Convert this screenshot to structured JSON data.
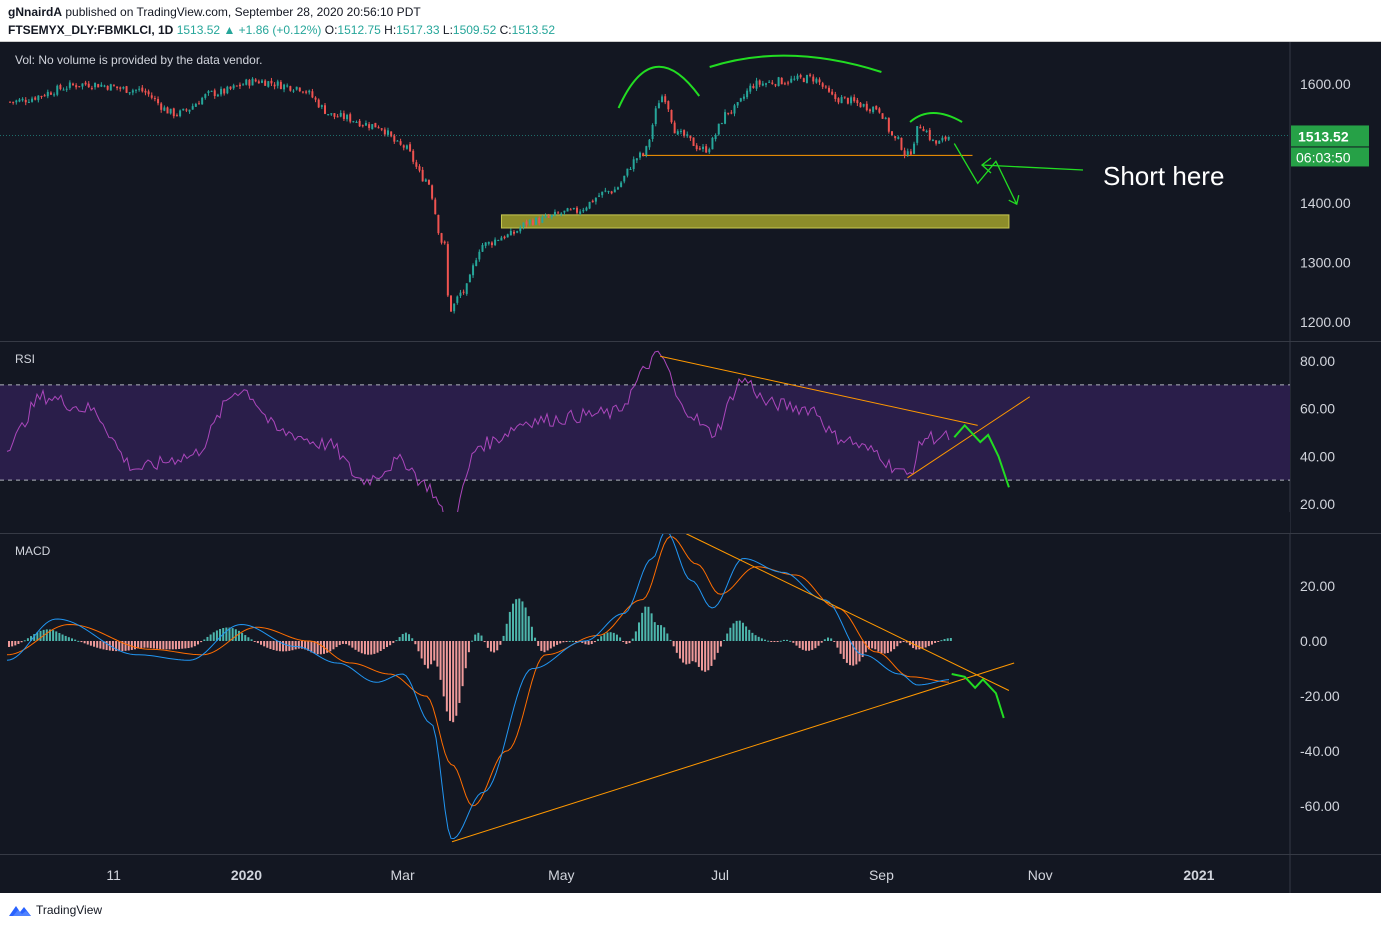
{
  "header": {
    "publisher_user": "gNnairdA",
    "published_text": "published on TradingView.com, September 28, 2020 20:56:10 PDT",
    "symbol": "FTSEMYX_DLY:FBMKLCI, 1D",
    "last": "1513.52",
    "change": "+1.86 (+0.12%)",
    "o_label": "O:",
    "open": "1512.75",
    "h_label": "H:",
    "high": "1517.33",
    "l_label": "L:",
    "low": "1509.52",
    "c_label": "C:",
    "close": "1513.52"
  },
  "footer": {
    "brand": "TradingView",
    "logo_icon": "tradingview-logo-icon"
  },
  "colors": {
    "background": "#131722",
    "up": "#26a69a",
    "down": "#ef5350",
    "rsi_line": "#ab47bc",
    "rsi_band": "#2a1e4a",
    "macd_line": "#2196f3",
    "signal_line": "#ff6d00",
    "trend_line": "#ff9800",
    "annotation": "#22dd22",
    "support_zone": "#8d8d2a"
  },
  "chart_data": [
    {
      "type": "candlestick",
      "panel": "price",
      "title": "FTSEMYX_DLY:FBMKLCI, 1D",
      "legend": "Vol: No volume is provided by the data vendor.",
      "x_tick_labels": [
        "11",
        "2020",
        "Mar",
        "May",
        "Jul",
        "Sep",
        "Nov",
        "2021"
      ],
      "y_tick_labels": [
        "1600.00",
        "1400.00",
        "1300.00",
        "1200.00"
      ],
      "ylim": [
        1170,
        1640
      ],
      "last_price_label": "1513.52",
      "countdown_label": "06:03:50",
      "annotation_text": "Short here",
      "anchor_prices": [
        {
          "date": "2019-10-01",
          "price": 1570
        },
        {
          "date": "2019-11-01",
          "price": 1600
        },
        {
          "date": "2019-11-20",
          "price": 1590
        },
        {
          "date": "2019-12-05",
          "price": 1550
        },
        {
          "date": "2019-12-20",
          "price": 1585
        },
        {
          "date": "2020-01-05",
          "price": 1605
        },
        {
          "date": "2020-01-20",
          "price": 1595
        },
        {
          "date": "2020-02-05",
          "price": 1545
        },
        {
          "date": "2020-02-20",
          "price": 1530
        },
        {
          "date": "2020-03-01",
          "price": 1495
        },
        {
          "date": "2020-03-10",
          "price": 1440
        },
        {
          "date": "2020-03-17",
          "price": 1330
        },
        {
          "date": "2020-03-19",
          "price": 1220
        },
        {
          "date": "2020-03-24",
          "price": 1250
        },
        {
          "date": "2020-04-01",
          "price": 1330
        },
        {
          "date": "2020-04-10",
          "price": 1345
        },
        {
          "date": "2020-04-20",
          "price": 1370
        },
        {
          "date": "2020-05-05",
          "price": 1385
        },
        {
          "date": "2020-05-20",
          "price": 1420
        },
        {
          "date": "2020-06-01",
          "price": 1480
        },
        {
          "date": "2020-06-09",
          "price": 1580
        },
        {
          "date": "2020-06-15",
          "price": 1515
        },
        {
          "date": "2020-06-25",
          "price": 1490
        },
        {
          "date": "2020-07-05",
          "price": 1555
        },
        {
          "date": "2020-07-15",
          "price": 1600
        },
        {
          "date": "2020-07-25",
          "price": 1605
        },
        {
          "date": "2020-08-05",
          "price": 1610
        },
        {
          "date": "2020-08-15",
          "price": 1575
        },
        {
          "date": "2020-08-30",
          "price": 1560
        },
        {
          "date": "2020-09-07",
          "price": 1505
        },
        {
          "date": "2020-09-11",
          "price": 1480
        },
        {
          "date": "2020-09-16",
          "price": 1530
        },
        {
          "date": "2020-09-22",
          "price": 1500
        },
        {
          "date": "2020-09-28",
          "price": 1513.52
        }
      ],
      "neckline": {
        "start_date": "2020-06-01",
        "end_date": "2020-10-06",
        "price": 1480
      },
      "support_zone": {
        "start_date": "2020-04-08",
        "end_date": "2020-10-20",
        "price_low": 1358,
        "price_high": 1380
      },
      "projection_path": [
        {
          "date": "2020-09-29",
          "price": 1500
        },
        {
          "date": "2020-10-08",
          "price": 1433
        },
        {
          "date": "2020-10-15",
          "price": 1470
        },
        {
          "date": "2020-10-23",
          "price": 1398
        }
      ],
      "pattern_arcs": [
        {
          "start_date": "2020-05-23",
          "peak_date": "2020-06-05",
          "end_date": "2020-06-23"
        },
        {
          "start_date": "2020-06-27",
          "peak_date": "2020-07-27",
          "end_date": "2020-09-01"
        },
        {
          "start_date": "2020-09-12",
          "peak_date": "2020-09-20",
          "end_date": "2020-10-02"
        }
      ]
    },
    {
      "type": "line",
      "panel": "rsi",
      "title": "RSI",
      "y_tick_labels": [
        "80.00",
        "60.00",
        "40.00",
        "20.00"
      ],
      "ylim": [
        10,
        85
      ],
      "band": [
        30,
        70
      ],
      "anchors": [
        {
          "date": "2019-10-01",
          "value": 45
        },
        {
          "date": "2019-10-15",
          "value": 65
        },
        {
          "date": "2019-11-01",
          "value": 60
        },
        {
          "date": "2019-11-20",
          "value": 35
        },
        {
          "date": "2019-12-10",
          "value": 40
        },
        {
          "date": "2019-12-30",
          "value": 68
        },
        {
          "date": "2020-01-15",
          "value": 50
        },
        {
          "date": "2020-02-01",
          "value": 45
        },
        {
          "date": "2020-02-15",
          "value": 30
        },
        {
          "date": "2020-03-01",
          "value": 38
        },
        {
          "date": "2020-03-10",
          "value": 28
        },
        {
          "date": "2020-03-19",
          "value": 13
        },
        {
          "date": "2020-03-31",
          "value": 45
        },
        {
          "date": "2020-04-20",
          "value": 55
        },
        {
          "date": "2020-05-20",
          "value": 58
        },
        {
          "date": "2020-06-08",
          "value": 82
        },
        {
          "date": "2020-06-17",
          "value": 60
        },
        {
          "date": "2020-06-28",
          "value": 50
        },
        {
          "date": "2020-07-10",
          "value": 72
        },
        {
          "date": "2020-07-20",
          "value": 62
        },
        {
          "date": "2020-08-05",
          "value": 60
        },
        {
          "date": "2020-08-15",
          "value": 48
        },
        {
          "date": "2020-08-30",
          "value": 42
        },
        {
          "date": "2020-09-05",
          "value": 36
        },
        {
          "date": "2020-09-11",
          "value": 32
        },
        {
          "date": "2020-09-18",
          "value": 48
        },
        {
          "date": "2020-09-28",
          "value": 48
        }
      ],
      "trendlines": [
        {
          "start_date": "2020-06-08",
          "start_value": 82,
          "end_date": "2020-10-08",
          "end_value": 53
        },
        {
          "start_date": "2020-09-11",
          "start_value": 31,
          "end_date": "2020-10-28",
          "end_value": 65
        }
      ],
      "projection_path": [
        {
          "date": "2020-09-29",
          "value": 48
        },
        {
          "date": "2020-10-03",
          "value": 53
        },
        {
          "date": "2020-10-09",
          "value": 46
        },
        {
          "date": "2020-10-12",
          "value": 49
        },
        {
          "date": "2020-10-16",
          "value": 40
        },
        {
          "date": "2020-10-20",
          "value": 27
        }
      ]
    },
    {
      "type": "line+bar",
      "panel": "macd",
      "title": "MACD",
      "y_tick_labels": [
        "20.00",
        "0.00",
        "-20.00",
        "-40.00",
        "-60.00"
      ],
      "ylim": [
        -78,
        40
      ],
      "macd_anchors": [
        {
          "date": "2019-10-01",
          "value": -7
        },
        {
          "date": "2019-10-20",
          "value": 8
        },
        {
          "date": "2019-11-20",
          "value": -5
        },
        {
          "date": "2019-12-10",
          "value": -7
        },
        {
          "date": "2019-12-30",
          "value": 6
        },
        {
          "date": "2020-01-20",
          "value": -2
        },
        {
          "date": "2020-02-05",
          "value": -8
        },
        {
          "date": "2020-02-20",
          "value": -15
        },
        {
          "date": "2020-03-01",
          "value": -12
        },
        {
          "date": "2020-03-12",
          "value": -30
        },
        {
          "date": "2020-03-20",
          "value": -72
        },
        {
          "date": "2020-04-01",
          "value": -55
        },
        {
          "date": "2020-04-20",
          "value": -10
        },
        {
          "date": "2020-05-10",
          "value": 0
        },
        {
          "date": "2020-05-25",
          "value": 10
        },
        {
          "date": "2020-06-05",
          "value": 30
        },
        {
          "date": "2020-06-10",
          "value": 40
        },
        {
          "date": "2020-06-20",
          "value": 22
        },
        {
          "date": "2020-06-28",
          "value": 12
        },
        {
          "date": "2020-07-10",
          "value": 30
        },
        {
          "date": "2020-07-25",
          "value": 25
        },
        {
          "date": "2020-08-10",
          "value": 15
        },
        {
          "date": "2020-08-25",
          "value": -5
        },
        {
          "date": "2020-09-08",
          "value": -12
        },
        {
          "date": "2020-09-15",
          "value": -16
        },
        {
          "date": "2020-09-28",
          "value": -14
        }
      ],
      "signal_anchors": [
        {
          "date": "2019-10-01",
          "value": -5
        },
        {
          "date": "2019-10-25",
          "value": 6
        },
        {
          "date": "2019-11-25",
          "value": -3
        },
        {
          "date": "2019-12-15",
          "value": -5
        },
        {
          "date": "2020-01-05",
          "value": 5
        },
        {
          "date": "2020-01-25",
          "value": 0
        },
        {
          "date": "2020-02-10",
          "value": -8
        },
        {
          "date": "2020-02-25",
          "value": -12
        },
        {
          "date": "2020-03-10",
          "value": -20
        },
        {
          "date": "2020-03-20",
          "value": -45
        },
        {
          "date": "2020-03-28",
          "value": -60
        },
        {
          "date": "2020-04-10",
          "value": -40
        },
        {
          "date": "2020-04-25",
          "value": -5
        },
        {
          "date": "2020-05-15",
          "value": 2
        },
        {
          "date": "2020-06-01",
          "value": 15
        },
        {
          "date": "2020-06-12",
          "value": 38
        },
        {
          "date": "2020-06-22",
          "value": 28
        },
        {
          "date": "2020-07-01",
          "value": 17
        },
        {
          "date": "2020-07-15",
          "value": 27
        },
        {
          "date": "2020-07-30",
          "value": 24
        },
        {
          "date": "2020-08-15",
          "value": 12
        },
        {
          "date": "2020-08-30",
          "value": -4
        },
        {
          "date": "2020-09-12",
          "value": -13
        },
        {
          "date": "2020-09-28",
          "value": -15
        }
      ],
      "trendlines": [
        {
          "start_date": "2020-03-20",
          "start_value": -73,
          "end_date": "2020-10-22",
          "end_value": -8
        },
        {
          "start_date": "2020-06-18",
          "start_value": 39,
          "end_date": "2020-10-20",
          "end_value": -18
        }
      ],
      "projection_path": [
        {
          "date": "2020-09-28",
          "value": -12
        },
        {
          "date": "2020-10-03",
          "value": -13
        },
        {
          "date": "2020-10-07",
          "value": -17
        },
        {
          "date": "2020-10-10",
          "value": -14
        },
        {
          "date": "2020-10-15",
          "value": -19
        },
        {
          "date": "2020-10-18",
          "value": -28
        }
      ]
    }
  ]
}
